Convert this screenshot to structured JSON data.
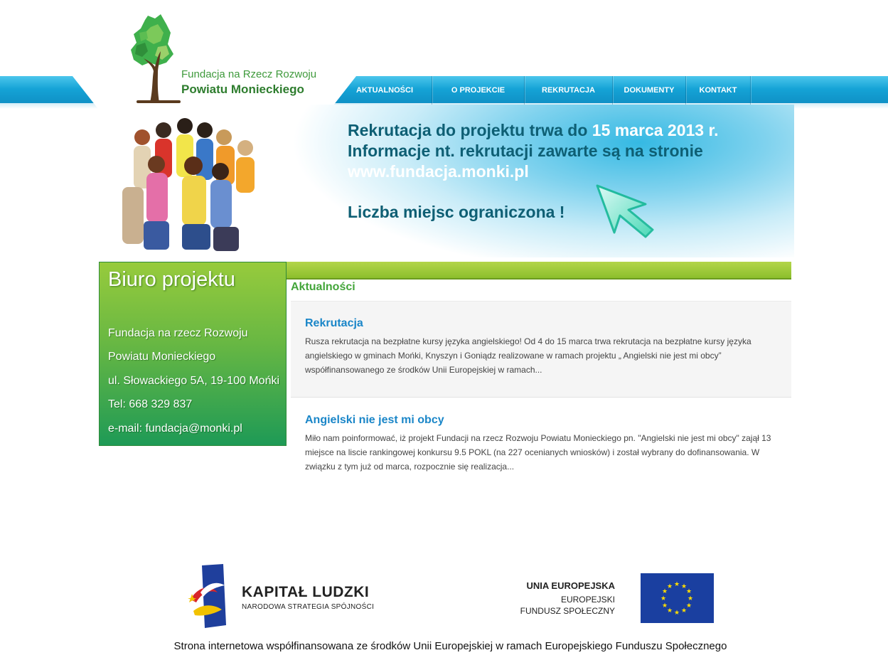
{
  "logo": {
    "line1": "Fundacja na Rzecz Rozwoju",
    "line2": "Powiatu Monieckiego"
  },
  "nav": [
    {
      "label": "AKTUALNOŚCI"
    },
    {
      "label": "O PROJEKCIE"
    },
    {
      "label": "REKRUTACJA"
    },
    {
      "label": "DOKUMENTY"
    },
    {
      "label": "KONTAKT"
    }
  ],
  "banner": {
    "line1_a": "Rekrutacja do projektu trwa do ",
    "line1_b": "15 marca 2013 r.",
    "line2": "Informacje nt. rekrutacji zawarte są na stronie",
    "line3": "www.fundacja.monki.pl",
    "line4": "Liczba miejsc ograniczona !"
  },
  "sidebar": {
    "title": "Biuro projektu",
    "lines": [
      "Fundacja na rzecz Rozwoju",
      "Powiatu Monieckiego",
      "ul. Słowackiego 5A, 19-100 Mońki",
      "Tel: 668 329 837",
      "e-mail: fundacja@monki.pl"
    ]
  },
  "main": {
    "heading": "Aktualności",
    "articles": [
      {
        "title": "Rekrutacja",
        "text": "Rusza rekrutacja na bezpłatne kursy języka angielskiego!   Od 4 do 15 marca trwa rekrutacja na bezpłatne kursy języka angielskiego w gminach Mońki, Knyszyn i Goniądz realizowane w ramach projektu „ Angielski nie jest mi obcy” współfinansowanego ze środków Unii Europejskiej w ramach..."
      },
      {
        "title": "Angielski nie jest mi obcy",
        "text": "Miło nam poinformować, iż projekt Fundacji na rzecz Rozwoju Powiatu Monieckiego pn. \"Angielski nie jest mi obcy\" zajął 13 miejsce na liscie rankingowej konkursu 9.5 POKL (na 227 ocenianych wniosków) i został wybrany do dofinansowania. W związku z tym już od marca, rozpocznie się realizacja..."
      }
    ]
  },
  "footer": {
    "kl_title": "KAPITAŁ LUDZKI",
    "kl_sub": "NARODOWA STRATEGIA SPÓJNOŚCI",
    "eu_t1": "UNIA EUROPEJSKA",
    "eu_t2": "EUROPEJSKI",
    "eu_t3": "FUNDUSZ SPOŁECZNY",
    "note": "Strona internetowa współfinansowana ze środków Unii Europejskiej w ramach Europejskiego Funduszu Społecznego"
  },
  "colors": {
    "nav_blue": "#15a3d6",
    "green": "#67b743",
    "link_blue": "#1a86c8",
    "banner_text": "#0e5f74"
  }
}
